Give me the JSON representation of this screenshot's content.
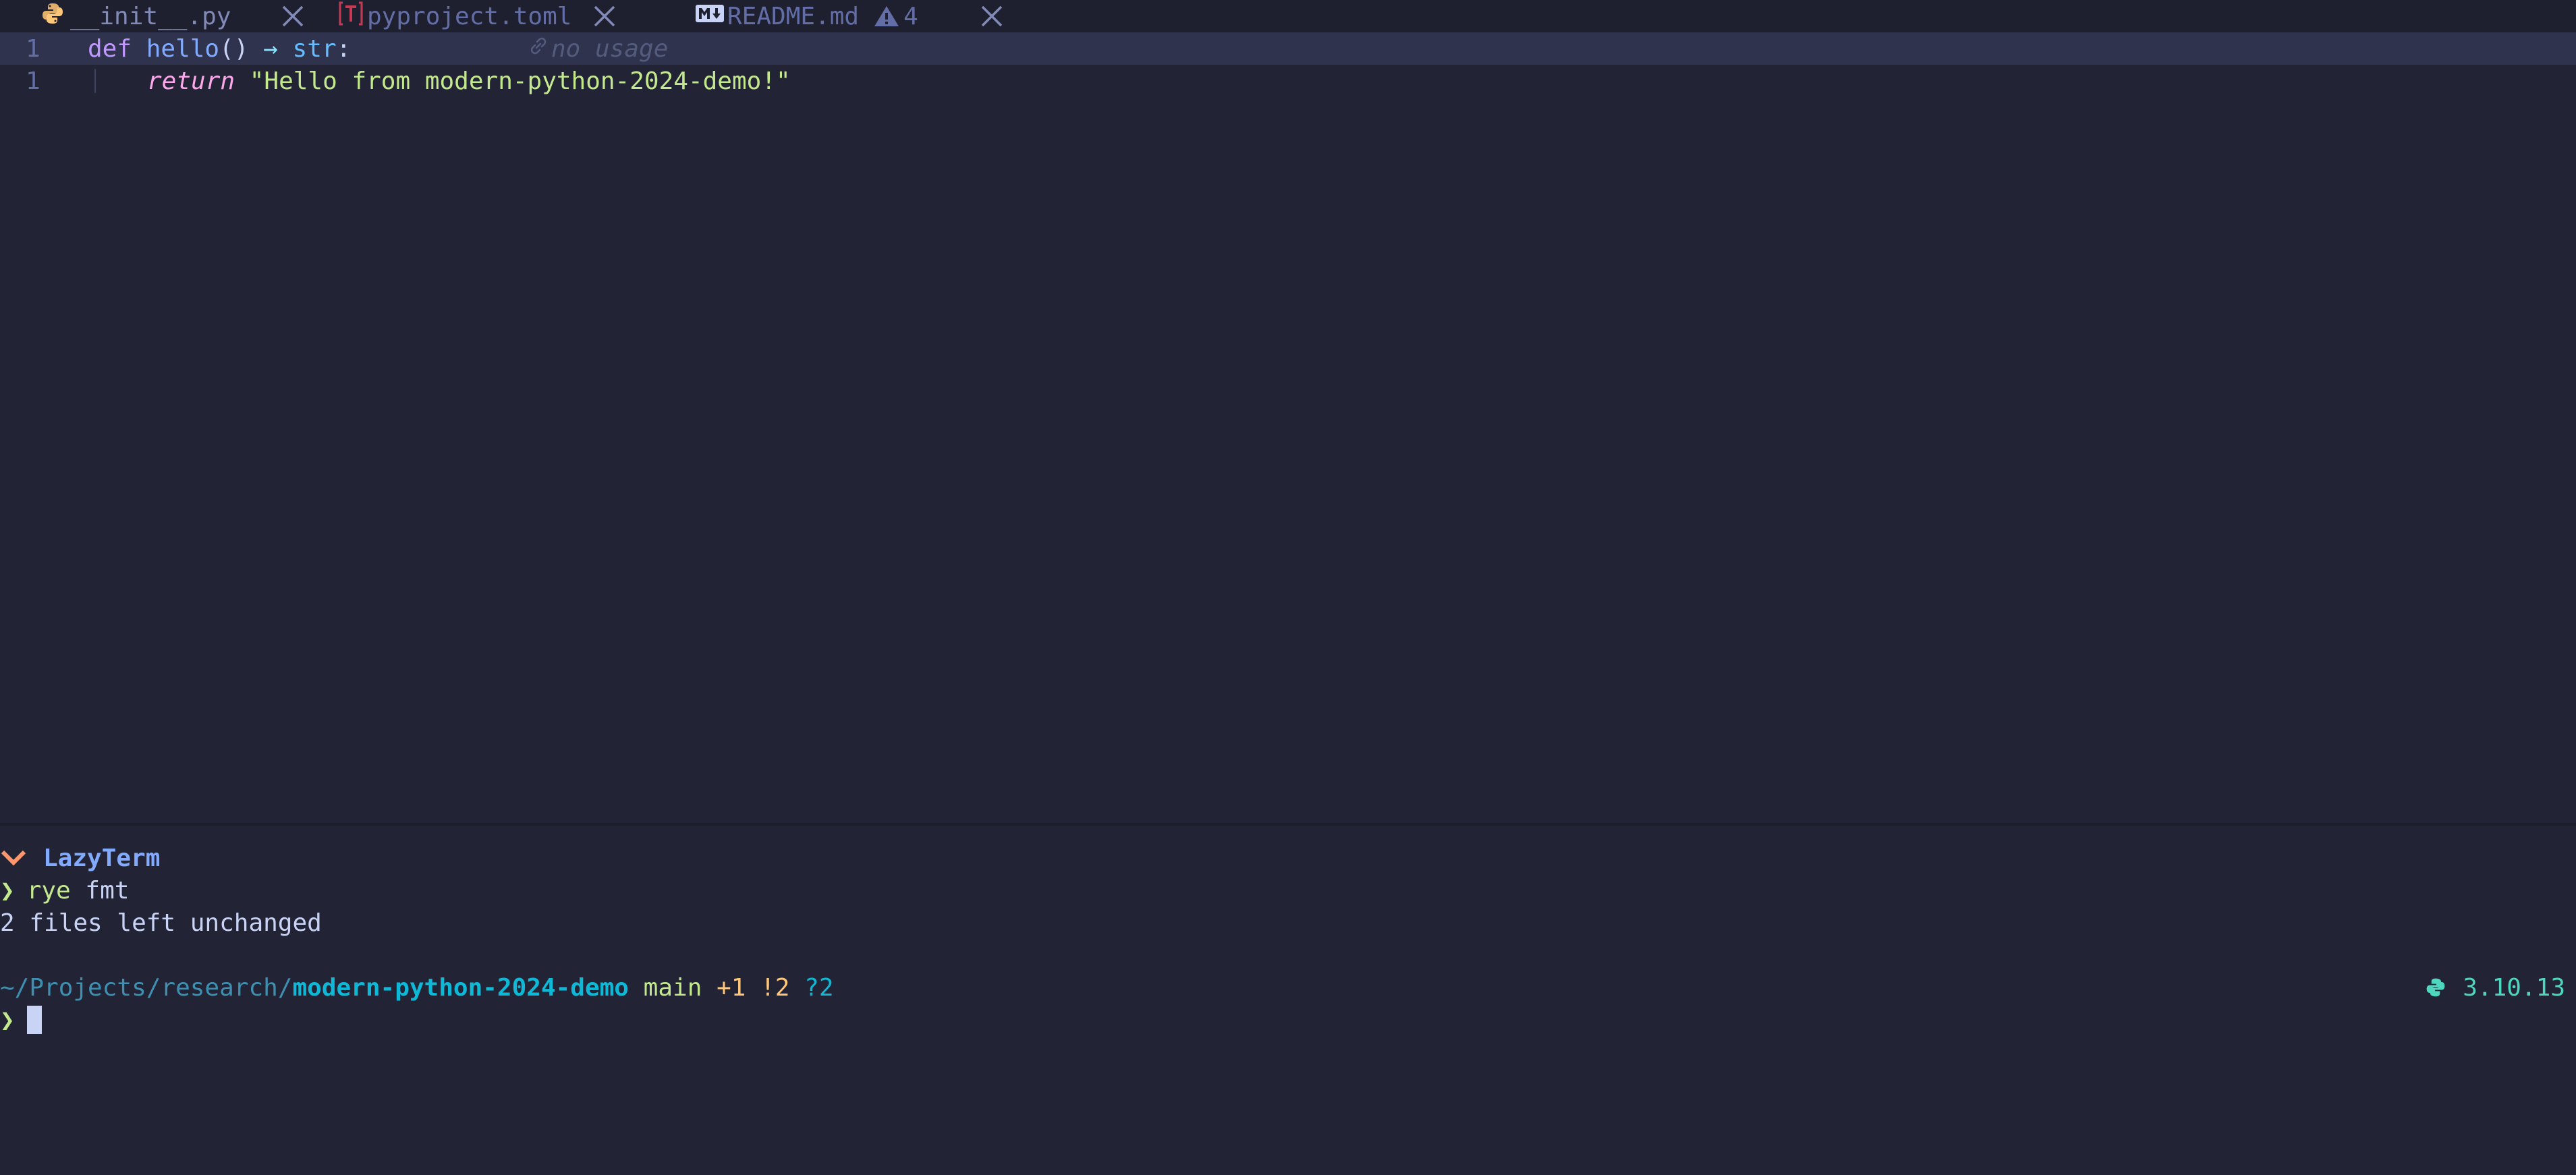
{
  "tabs": [
    {
      "label": "__init__.py",
      "icon": "python-icon",
      "active": true
    },
    {
      "label": "pyproject.toml",
      "icon": "toml-icon",
      "active": false
    },
    {
      "label": "README.md",
      "icon": "markdown-icon",
      "active": false,
      "warnings": "4"
    }
  ],
  "editor": {
    "lines": [
      {
        "number": "1",
        "keyword": "def",
        "name": "hello",
        "params": "()",
        "arrow": "→",
        "type": "str",
        "colon": ":",
        "hint": "no usage"
      },
      {
        "number": "1",
        "keyword": "return",
        "string": "\"Hello from modern-python-2024-demo!\""
      }
    ]
  },
  "terminal": {
    "title": "LazyTerm",
    "history": [
      {
        "prompt": "❯",
        "command": "rye",
        "args": " fmt"
      },
      {
        "output": "2 files left unchanged"
      }
    ],
    "prompt_line": {
      "path_prefix": "~/Projects/research/",
      "path_dir": "modern-python-2024-demo",
      "branch": "main",
      "staged": "+1",
      "modified": "!2",
      "untracked": "?2",
      "python_version": "3.10.13"
    },
    "input_prompt": "❯"
  },
  "colors": {
    "background": "#222436",
    "tabbar": "#1e2030",
    "accent": "#82aaff",
    "string": "#c3e88d",
    "keyword": "#c099ff"
  }
}
